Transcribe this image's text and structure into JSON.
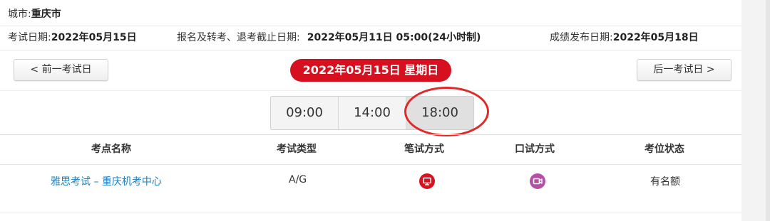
{
  "city": {
    "label": "城市:",
    "value": "重庆市"
  },
  "dates": {
    "exam_label": "考试日期:",
    "exam_value": "2022年05月15日",
    "deadline_label": "报名及转考、退考截止日期:",
    "deadline_value": "2022年05月11日 05:00(24小时制)",
    "result_label": "成绩发布日期:",
    "result_value": "2022年05月18日"
  },
  "nav": {
    "prev_label": "< 前一考试日",
    "current_date": "2022年05月15日 星期日",
    "next_label": "后一考试日 >"
  },
  "times": [
    "09:00",
    "14:00",
    "18:00"
  ],
  "selected_time": "18:00",
  "table": {
    "headers": [
      "考点名称",
      "考试类型",
      "笔试方式",
      "口试方式",
      "考位状态"
    ],
    "rows": [
      {
        "venue": "雅思考试 – 重庆机考中心",
        "type": "A/G",
        "written_icon": "computer-icon",
        "speaking_icon": "video-icon",
        "status": "有名额"
      }
    ]
  },
  "colors": {
    "accent_red": "#d6101f",
    "link_blue": "#1a7fc1",
    "speaking_purple": "#b54fa7",
    "highlight_ring": "#e02a2a"
  }
}
